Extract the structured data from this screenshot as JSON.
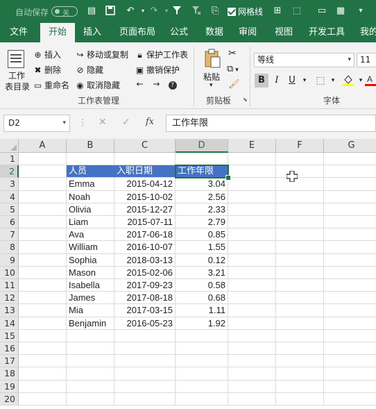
{
  "qat": {
    "autosave_label": "自动保存",
    "autosave_state": "关",
    "gridlines_label": "网格线"
  },
  "tabs": [
    "文件",
    "开始",
    "插入",
    "页面布局",
    "公式",
    "数据",
    "审阅",
    "视图",
    "开发工具",
    "我的"
  ],
  "active_tab": "开始",
  "ribbon": {
    "sheet_group": {
      "big_button_line1": "工作",
      "big_button_line2": "表目录",
      "insert": "插入",
      "delete": "删除",
      "rename": "重命名",
      "move_copy": "移动或复制",
      "hide": "隐藏",
      "unhide": "取消隐藏",
      "protect_sheet": "保护工作表",
      "unprotect": "撤销保护",
      "group_label": "工作表管理"
    },
    "clipboard": {
      "paste": "粘贴",
      "group_label": "剪贴板"
    },
    "font": {
      "name": "等线",
      "size": "11",
      "bold": "B",
      "italic": "I",
      "underline": "U",
      "group_label": "字体"
    }
  },
  "formula_bar": {
    "name_box": "D2",
    "fx": "fx",
    "content": "工作年限"
  },
  "sheet": {
    "columns": [
      "A",
      "B",
      "C",
      "D",
      "E",
      "F",
      "G"
    ],
    "selected_column": "D",
    "selected_row": "2",
    "rows": [
      "1",
      "2",
      "3",
      "4",
      "5",
      "6",
      "7",
      "8",
      "9",
      "10",
      "11",
      "12",
      "13",
      "14",
      "15",
      "16",
      "17",
      "18",
      "19",
      "20"
    ],
    "header": [
      "人员",
      "入职日期",
      "工作年限"
    ],
    "data": [
      [
        "Emma",
        "2015-04-12",
        "3.04"
      ],
      [
        "Noah",
        "2015-10-02",
        "2.56"
      ],
      [
        "Olivia",
        "2015-12-27",
        "2.33"
      ],
      [
        "Liam",
        "2015-07-11",
        "2.79"
      ],
      [
        "Ava",
        "2017-06-18",
        "0.85"
      ],
      [
        "William",
        "2016-10-07",
        "1.55"
      ],
      [
        "Sophia",
        "2018-03-13",
        "0.12"
      ],
      [
        "Mason",
        "2015-02-06",
        "3.21"
      ],
      [
        "Isabella",
        "2017-09-23",
        "0.58"
      ],
      [
        "James",
        "2017-08-18",
        "0.68"
      ],
      [
        "Mia",
        "2017-03-15",
        "1.11"
      ],
      [
        "Benjamin",
        "2016-05-23",
        "1.92"
      ]
    ]
  },
  "colors": {
    "brand_green": "#217346",
    "header_fill": "#4472c4"
  }
}
